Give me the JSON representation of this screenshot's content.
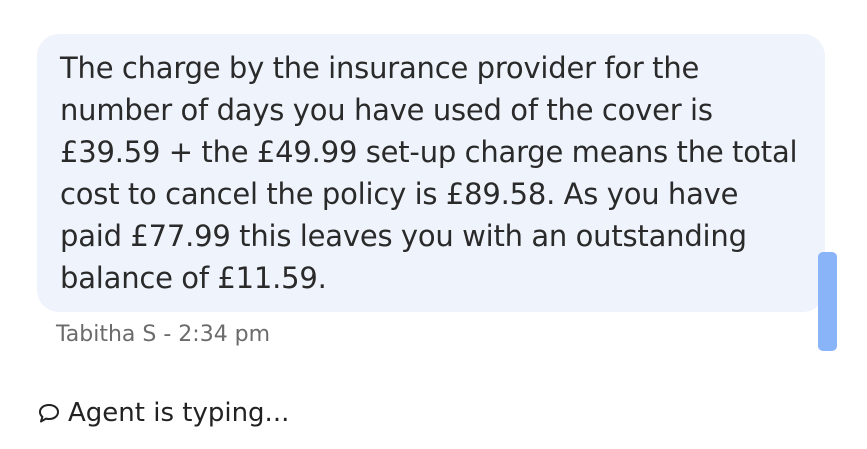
{
  "message": {
    "text": "The charge by the insurance provider for the number of days you have used of the cover is £39.59 + the £49.99 set-up charge means the total cost to cancel the policy is £89.58. As you have paid £77.99 this leaves you with an outstanding balance of £11.59.",
    "meta": "Tabitha S - 2:34 pm"
  },
  "typing": {
    "icon": "chat-bubble-icon",
    "text": "Agent is typing..."
  },
  "colors": {
    "bubble_bg": "#eef3fc",
    "scroll_thumb": "#8ab4f8"
  }
}
